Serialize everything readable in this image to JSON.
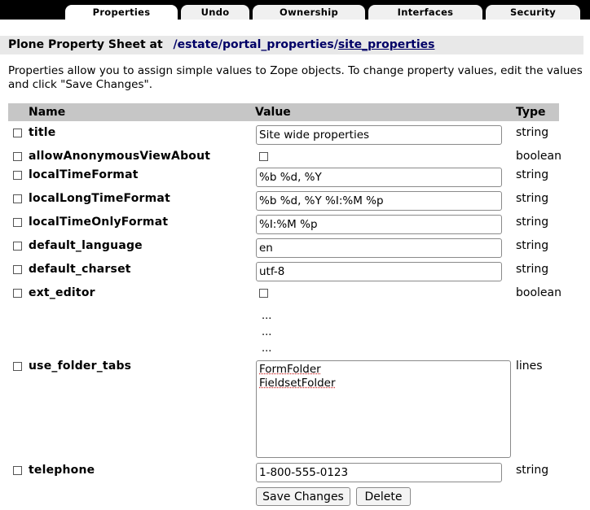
{
  "tabs": [
    {
      "label": "Properties",
      "active": true
    },
    {
      "label": "Undo"
    },
    {
      "label": "Ownership"
    },
    {
      "label": "Interfaces"
    },
    {
      "label": "Security"
    }
  ],
  "header": {
    "title": "Plone Property Sheet at",
    "path_sep": "/",
    "path": [
      "estate",
      "portal_properties",
      "site_properties"
    ]
  },
  "intro": "Properties allow you to assign simple values to Zope objects. To change property values, edit the values and click \"Save Changes\".",
  "columns": {
    "name": "Name",
    "value": "Value",
    "type": "Type"
  },
  "properties": [
    {
      "name": "title",
      "value": "Site wide properties",
      "type": "string"
    },
    {
      "name": "allowAnonymousViewAbout",
      "value": false,
      "type": "boolean"
    },
    {
      "name": "localTimeFormat",
      "value": "%b %d, %Y",
      "type": "string"
    },
    {
      "name": "localLongTimeFormat",
      "value": "%b %d, %Y %I:%M %p",
      "type": "string"
    },
    {
      "name": "localTimeOnlyFormat",
      "value": "%I:%M %p",
      "type": "string"
    },
    {
      "name": "default_language",
      "value": "en",
      "type": "string"
    },
    {
      "name": "default_charset",
      "value": "utf-8",
      "type": "string"
    },
    {
      "name": "ext_editor",
      "value": false,
      "type": "boolean"
    },
    {
      "name": "use_folder_tabs",
      "values": [
        "FormFolder",
        "FieldsetFolder"
      ],
      "type": "lines"
    },
    {
      "name": "telephone",
      "value": "1-800-555-0123",
      "type": "string"
    }
  ],
  "ellipsis": [
    "...",
    "...",
    "..."
  ],
  "buttons": {
    "save": "Save Changes",
    "delete": "Delete"
  }
}
